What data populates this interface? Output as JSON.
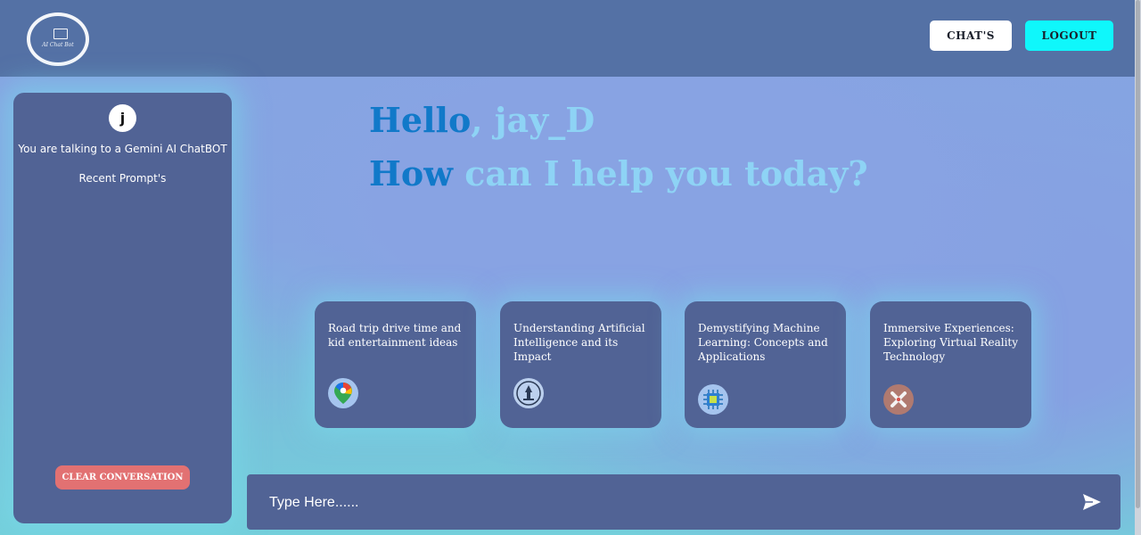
{
  "header": {
    "logo_text": "AI Chat Bot",
    "chats_button": "CHAT'S",
    "logout_button": "LOGOUT"
  },
  "sidebar": {
    "avatar_initial": "j",
    "subtitle": "You are talking to a Gemini AI ChatBOT",
    "recent_label": "Recent Prompt's",
    "clear_button": "CLEAR CONVERSATION"
  },
  "greeting": {
    "line1_dark": "Hello",
    "line1_light": ", jay_D",
    "line2_dark": "How ",
    "line2_light": "can I help you today?"
  },
  "cards": [
    {
      "text": "Road trip drive time and kid entertainment ideas",
      "icon": "maps-pin-icon"
    },
    {
      "text": "Understanding Artificial Intelligence and its Impact",
      "icon": "ai-emblem-icon"
    },
    {
      "text": "Demystifying Machine Learning: Concepts and Applications",
      "icon": "chip-icon"
    },
    {
      "text": "Immersive Experiences: Exploring Virtual Reality Technology",
      "icon": "tools-icon"
    }
  ],
  "input": {
    "placeholder": "Type Here......",
    "value": ""
  },
  "colors": {
    "topbar": "#5471a5",
    "panel": "#516395",
    "accent_cyan": "#0ff7fb",
    "clear_red": "#e27172",
    "greeting_dark": "#1179c9",
    "greeting_light": "#8ed3f5"
  }
}
